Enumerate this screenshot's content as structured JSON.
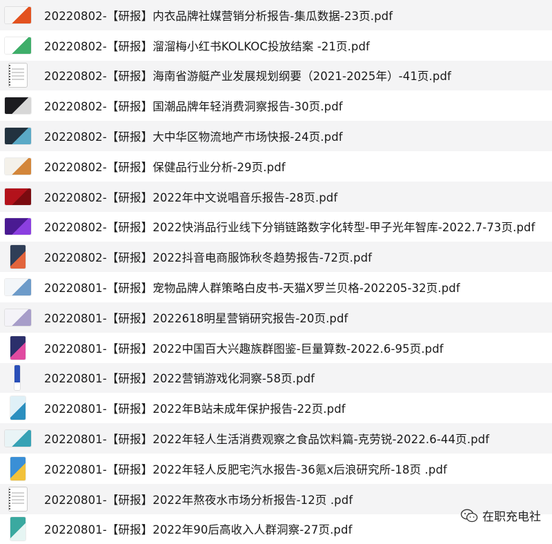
{
  "files": [
    {
      "name": "20220802-【研报】内衣品牌社媒营销分析报告-集瓜数据-23页.pdf",
      "thumb": {
        "style": "wide",
        "colors": [
          "#f6f6f6",
          "#e3521f"
        ]
      }
    },
    {
      "name": "20220802-【研报】溜溜梅小红书KOLKOC投放结案 -21页.pdf",
      "thumb": {
        "style": "wide",
        "colors": [
          "#ffffff",
          "#3fae6a"
        ]
      }
    },
    {
      "name": "20220802-【研报】海南省游艇产业发展规划纲要（2021-2025年）-41页.pdf",
      "thumb": {
        "style": "doc",
        "colors": [
          "#ffffff",
          "#cfcfcf"
        ]
      }
    },
    {
      "name": "20220802-【研报】国潮品牌年轻消费洞察报告-30页.pdf",
      "thumb": {
        "style": "wide",
        "colors": [
          "#1b1b1f",
          "#d7d7d7"
        ]
      }
    },
    {
      "name": "20220802-【研报】大中华区物流地产市场快报-24页.pdf",
      "thumb": {
        "style": "wide",
        "colors": [
          "#22323f",
          "#5aa9c6"
        ]
      }
    },
    {
      "name": "20220802-【研报】保健品行业分析-29页.pdf",
      "thumb": {
        "style": "wide",
        "colors": [
          "#f4f1ea",
          "#d3863a"
        ]
      }
    },
    {
      "name": "20220802-【研报】2022年中文说唱音乐报告-28页.pdf",
      "thumb": {
        "style": "wide",
        "colors": [
          "#b3121b",
          "#7a0b10"
        ]
      }
    },
    {
      "name": "20220802-【研报】2022快消品行业线下分销链路数字化转型-甲子光年智库-2022.7-73页.pdf",
      "thumb": {
        "style": "wide",
        "colors": [
          "#4a1a92",
          "#8b3fe0"
        ]
      }
    },
    {
      "name": "20220802-【研报】2022抖音电商服饰秋冬趋势报告-72页.pdf",
      "thumb": {
        "style": "tall",
        "colors": [
          "#2f3e57",
          "#e2643c"
        ]
      }
    },
    {
      "name": "20220801-【研报】宠物品牌人群策略白皮书-天猫X罗兰贝格-202205-32页.pdf",
      "thumb": {
        "style": "wide",
        "colors": [
          "#f3f6f9",
          "#6d9bc9"
        ]
      }
    },
    {
      "name": "20220801-【研报】2022618明星营销研究报告-20页.pdf",
      "thumb": {
        "style": "wide",
        "colors": [
          "#f4f3f8",
          "#a79dc9"
        ]
      }
    },
    {
      "name": "20220801-【研报】2022中国百大兴趣族群图鉴-巨量算数-2022.6-95页.pdf",
      "thumb": {
        "style": "tall",
        "colors": [
          "#2b2f6b",
          "#e04aa0"
        ]
      }
    },
    {
      "name": "20220801-【研报】2022营销游戏化洞察-58页.pdf",
      "thumb": {
        "style": "narrow",
        "colors": [
          "#2a4fb8",
          "#ffffff"
        ]
      }
    },
    {
      "name": "20220801-【研报】2022年B站未成年保护报告-22页.pdf",
      "thumb": {
        "style": "tall",
        "colors": [
          "#dff0f7",
          "#2b8fbf"
        ]
      }
    },
    {
      "name": "20220801-【研报】2022年轻人生活消费观察之食品饮料篇-克劳锐-2022.6-44页.pdf",
      "thumb": {
        "style": "wide",
        "colors": [
          "#e9f4f6",
          "#37a2b5"
        ]
      }
    },
    {
      "name": "20220801-【研报】2022年轻人反肥宅汽水报告-36氪x后浪研究所-18页 .pdf",
      "thumb": {
        "style": "tall",
        "colors": [
          "#3a8fd6",
          "#f2c23a"
        ]
      }
    },
    {
      "name": "20220801-【研报】2022年熬夜水市场分析报告-12页 .pdf",
      "thumb": {
        "style": "doc",
        "colors": [
          "#ffffff",
          "#cfcfcf"
        ]
      }
    },
    {
      "name": "20220801-【研报】2022年90后高收入人群洞察-27页.pdf",
      "thumb": {
        "style": "tall",
        "colors": [
          "#3aa9a0",
          "#e6f5f3"
        ]
      }
    }
  ],
  "watermark": {
    "icon": "wechat-icon",
    "text": "在职充电社"
  }
}
